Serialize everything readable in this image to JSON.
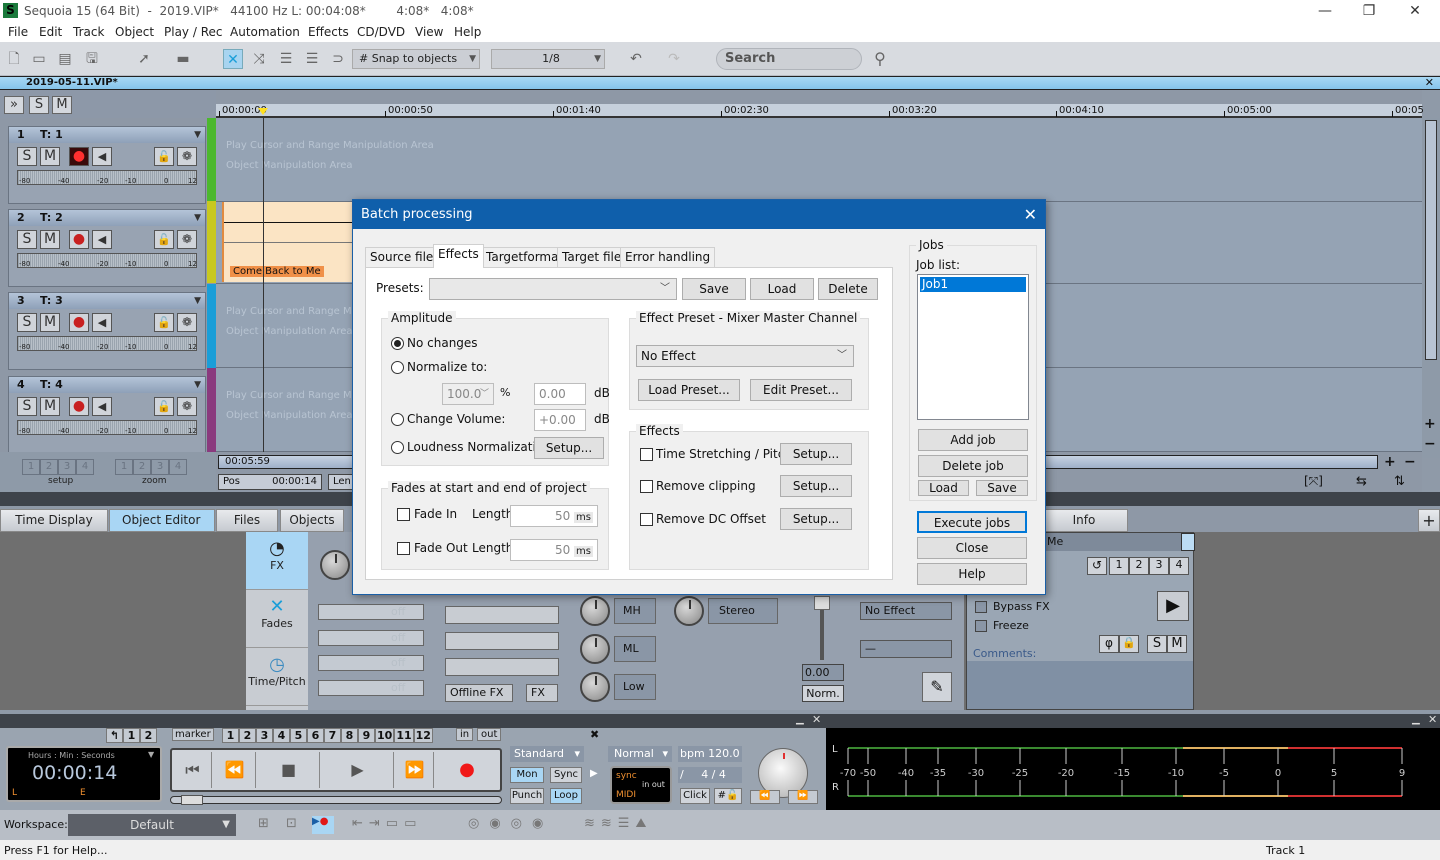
{
  "window": {
    "title": "Sequoia 15 (64 Bit)  -  2019.VIP*   44100 Hz L: 00:04:08*        4:08*   4:08*",
    "logo": "S",
    "minimize": "—",
    "maximize": "❐",
    "close": "✕"
  },
  "menu": [
    "File",
    "Edit",
    "Track",
    "Object",
    "Play / Rec",
    "Automation",
    "Effects",
    "CD/DVD",
    "View",
    "Help"
  ],
  "toolbar": {
    "snap": "Snap to objects",
    "zoom": "1/8",
    "search_placeholder": "Search"
  },
  "project": {
    "tab": "2019-05-11.VIP*",
    "close": "✕"
  },
  "ruler": [
    "00:00:00",
    "00:00:50",
    "00:01:40",
    "00:02:30",
    "00:03:20",
    "00:04:10",
    "00:05:00",
    "00:05"
  ],
  "tracks": [
    {
      "num": "1",
      "name": "T: 1",
      "color": "#4cb82e",
      "armed": true
    },
    {
      "num": "2",
      "name": "T: 2",
      "color": "#c8c820",
      "armed": false
    },
    {
      "num": "3",
      "name": "T: 3",
      "color": "#1a9ed8",
      "armed": false
    },
    {
      "num": "4",
      "name": "T: 4",
      "color": "#8a3a7e",
      "armed": false
    }
  ],
  "track_buttons": {
    "solo": "S",
    "mute": "M"
  },
  "meter_scale": [
    "-80",
    "-40",
    "-20",
    "-10",
    "0",
    "12"
  ],
  "lane_hints": {
    "play": "Play Cursor and Range Manipulation Area",
    "object": "Object Manipulation Area"
  },
  "clip": {
    "name": "Come Back to Me"
  },
  "setup_zoom": {
    "nums": [
      "1",
      "2",
      "3",
      "4"
    ],
    "setup_label": "setup",
    "zoom_label": "zoom"
  },
  "range": {
    "end": "00:05:59",
    "pos_label": "Pos",
    "pos_value": "00:00:14",
    "len_label": "Len"
  },
  "panel_tabs": [
    "Time Display",
    "Object Editor",
    "Files",
    "Objects",
    "Info"
  ],
  "object_editor": {
    "nav": [
      "FX",
      "Fades",
      "Time/Pitch"
    ],
    "slots_off": [
      "off",
      "off",
      "off",
      "off"
    ],
    "offline_fx": "Offline FX",
    "fx": "FX",
    "eq_bands": [
      "MH",
      "ML",
      "Low"
    ],
    "stereo": "Stereo",
    "volume": "0.00",
    "norm": "Norm.",
    "no_effect": "No Effect",
    "dash": "—",
    "object_name": "Me",
    "takes": [
      "1",
      "2",
      "3",
      "4"
    ],
    "bypass_fx": "Bypass FX",
    "freeze": "Freeze",
    "comments": "Comments:",
    "solo": "S",
    "mute": "M",
    "phase": "φ"
  },
  "transport": {
    "loc_btns": [
      "↰",
      "1",
      "2"
    ],
    "marker": "marker",
    "markers": [
      "1",
      "2",
      "3",
      "4",
      "5",
      "6",
      "7",
      "8",
      "9",
      "10",
      "11",
      "12"
    ],
    "in": "in",
    "out": "out",
    "time_format": "Hours : Min : Seconds",
    "time": "00:00:14",
    "L": "L",
    "E": "E",
    "mode": "Standard",
    "mon": "Mon",
    "sync": "Sync",
    "punch": "Punch",
    "loop": "Loop",
    "speed": "Normal",
    "bpm": "bpm  120.0",
    "meter": "/     4 / 4",
    "click": "Click",
    "sync_lbl": "sync",
    "midi_lbl": "MIDI",
    "inout": "in  out"
  },
  "peak_meter": {
    "channels": [
      "L",
      "R"
    ],
    "scale": [
      "-70",
      "-50",
      "-40",
      "-35",
      "-30",
      "-25",
      "-20",
      "-15",
      "-10",
      "-5",
      "0",
      "5",
      "9"
    ]
  },
  "workspace": {
    "label": "Workspace:",
    "value": "Default"
  },
  "status": {
    "help": "Press F1 for Help...",
    "track": "Track 1"
  },
  "dialog": {
    "title": "Batch processing",
    "tabs": [
      "Source files",
      "Effects",
      "Targetformat",
      "Target files",
      "Error handling"
    ],
    "active_tab": "Effects",
    "presets_label": "Presets:",
    "presets_value": "",
    "save": "Save",
    "load": "Load",
    "delete": "Delete",
    "amplitude": {
      "title": "Amplitude",
      "no_changes": "No changes",
      "normalize": "Normalize to:",
      "normalize_pct": "100.0",
      "pct": "%",
      "normalize_db": "0.00",
      "db": "dB",
      "change_volume": "Change Volume:",
      "volume_db": "+0.00",
      "loudness": "Loudness Normalization:",
      "setup": "Setup...",
      "selected": "No changes"
    },
    "fades": {
      "title": "Fades at start and end of project",
      "fade_in": "Fade In",
      "fade_out": "Fade Out",
      "length": "Length:",
      "fade_in_ms": "50",
      "fade_out_ms": "50",
      "ms": "ms"
    },
    "effect_preset": {
      "title": "Effect Preset - Mixer Master Channel",
      "value": "No Effect",
      "load": "Load Preset...",
      "edit": "Edit Preset..."
    },
    "effects": {
      "title": "Effects",
      "items": [
        "Time Stretching / Pitch Sh.",
        "Remove clipping",
        "Remove DC Offset"
      ],
      "setup": "Setup..."
    },
    "jobs": {
      "title": "Jobs",
      "list_label": "Job list:",
      "items": [
        "Job1"
      ],
      "add": "Add job",
      "delete": "Delete job",
      "load": "Load",
      "save": "Save",
      "execute": "Execute jobs",
      "close": "Close",
      "help": "Help"
    },
    "close_icon": "✕"
  }
}
